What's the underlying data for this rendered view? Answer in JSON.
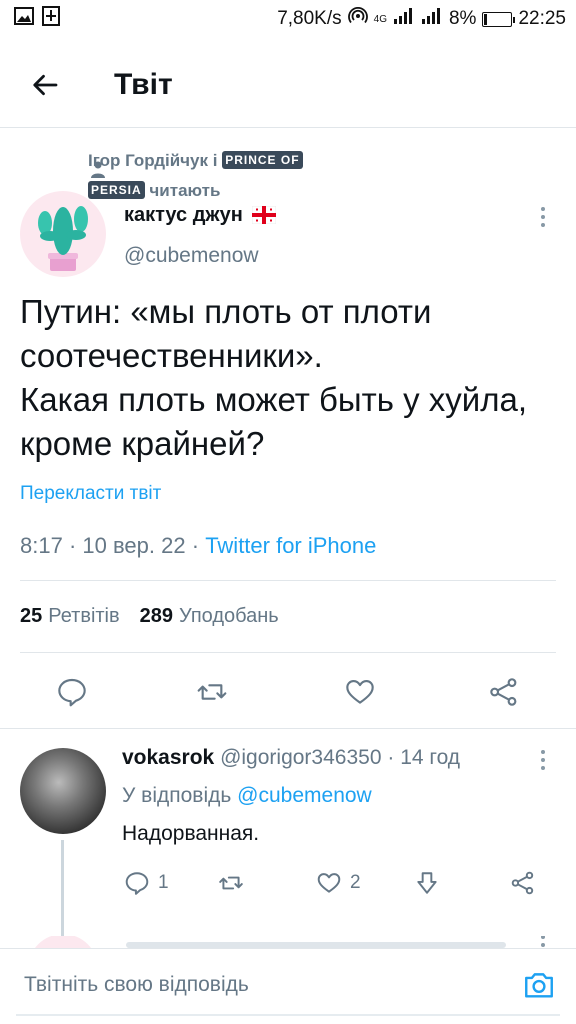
{
  "status_bar": {
    "speed": "7,80K/s",
    "network": "4G",
    "battery": "8%",
    "time": "22:25"
  },
  "header": {
    "title": "Твіт"
  },
  "context": {
    "prefix": "Ігор Гордійчук і",
    "tile_line1": "PRINCE OF",
    "tile_line2": "PERSIA",
    "suffix": "читають"
  },
  "author": {
    "name": "кактус джун",
    "handle": "@cubemenow"
  },
  "tweet": {
    "text": "Путин: «мы плоть от плоти соотечественники».\nКакая плоть может быть у хуйла, кроме крайней?",
    "translate_label": "Перекласти твіт",
    "time": "8:17",
    "date": "10 вер. 22",
    "source": "Twitter for iPhone"
  },
  "stats": {
    "retweets_count": "25",
    "retweets_label": "Ретвітів",
    "likes_count": "289",
    "likes_label": "Уподобань"
  },
  "reply": {
    "name": "vokasrok",
    "handle": "@igorigor346350",
    "time": "14 год",
    "reply_to_prefix": "У відповідь",
    "reply_to_handle": "@cubemenow",
    "text": "Надорванная.",
    "reply_count": "1",
    "like_count": "2"
  },
  "composer": {
    "placeholder": "Твітніть свою відповідь"
  },
  "colors": {
    "accent": "#1da1f2",
    "secondary_text": "#657786",
    "primary_text": "#0f1419",
    "divider": "#e1e6ea"
  }
}
